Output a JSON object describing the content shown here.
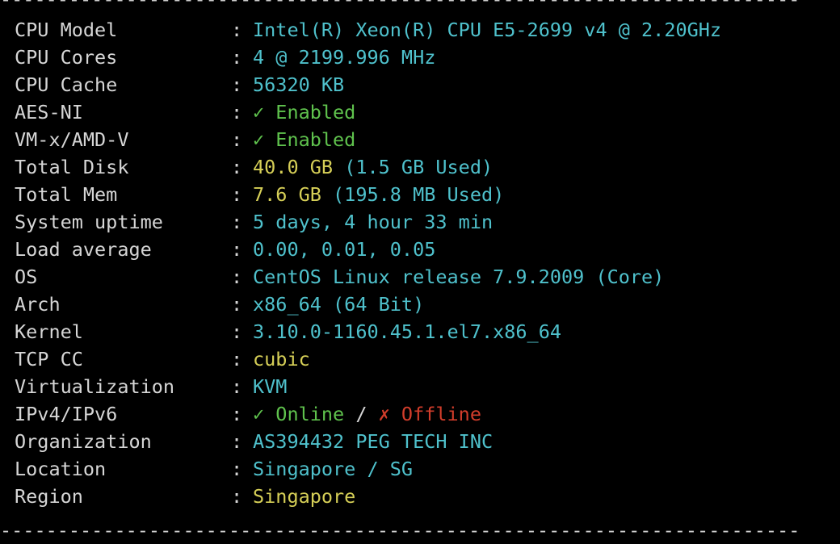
{
  "terminal": {
    "rule": "------------------------------------------------------------------------",
    "separator": ":",
    "rows": [
      {
        "label": "CPU Model",
        "parts": [
          {
            "text": "Intel(R) Xeon(R) CPU E5-2699 v4 @ 2.20GHz",
            "color": "cyan"
          }
        ]
      },
      {
        "label": "CPU Cores",
        "parts": [
          {
            "text": "4 @ 2199.996 MHz",
            "color": "cyan"
          }
        ]
      },
      {
        "label": "CPU Cache",
        "parts": [
          {
            "text": "56320 KB",
            "color": "cyan"
          }
        ]
      },
      {
        "label": "AES-NI",
        "parts": [
          {
            "text": "✓ Enabled",
            "color": "green"
          }
        ]
      },
      {
        "label": "VM-x/AMD-V",
        "parts": [
          {
            "text": "✓ Enabled",
            "color": "green"
          }
        ]
      },
      {
        "label": "Total Disk",
        "parts": [
          {
            "text": "40.0 GB",
            "color": "yellow"
          },
          {
            "text": " (1.5 GB Used)",
            "color": "cyan"
          }
        ]
      },
      {
        "label": "Total Mem",
        "parts": [
          {
            "text": "7.6 GB",
            "color": "yellow"
          },
          {
            "text": " (195.8 MB Used)",
            "color": "cyan"
          }
        ]
      },
      {
        "label": "System uptime",
        "parts": [
          {
            "text": "5 days, 4 hour 33 min",
            "color": "cyan"
          }
        ]
      },
      {
        "label": "Load average",
        "parts": [
          {
            "text": "0.00, 0.01, 0.05",
            "color": "cyan"
          }
        ]
      },
      {
        "label": "OS",
        "parts": [
          {
            "text": "CentOS Linux release 7.9.2009 (Core)",
            "color": "cyan"
          }
        ]
      },
      {
        "label": "Arch",
        "parts": [
          {
            "text": "x86_64 (64 Bit)",
            "color": "cyan"
          }
        ]
      },
      {
        "label": "Kernel",
        "parts": [
          {
            "text": "3.10.0-1160.45.1.el7.x86_64",
            "color": "cyan"
          }
        ]
      },
      {
        "label": "TCP CC",
        "parts": [
          {
            "text": "cubic",
            "color": "yellow"
          }
        ]
      },
      {
        "label": "Virtualization",
        "parts": [
          {
            "text": "KVM",
            "color": "cyan"
          }
        ]
      },
      {
        "label": "IPv4/IPv6",
        "parts": [
          {
            "text": "✓ Online",
            "color": "green"
          },
          {
            "text": " / ",
            "color": "white"
          },
          {
            "text": "✗ Offline",
            "color": "red"
          }
        ]
      },
      {
        "label": "Organization",
        "parts": [
          {
            "text": "AS394432 PEG TECH INC",
            "color": "cyan"
          }
        ]
      },
      {
        "label": "Location",
        "parts": [
          {
            "text": "Singapore / SG",
            "color": "cyan"
          }
        ]
      },
      {
        "label": "Region",
        "parts": [
          {
            "text": "Singapore",
            "color": "yellow"
          }
        ]
      }
    ]
  },
  "colors": {
    "background": "#000000",
    "label": "#d6d6d6",
    "cyan": "#4fc1cc",
    "yellow": "#d6cf57",
    "green": "#5fc24d",
    "red": "#d23d2b"
  }
}
